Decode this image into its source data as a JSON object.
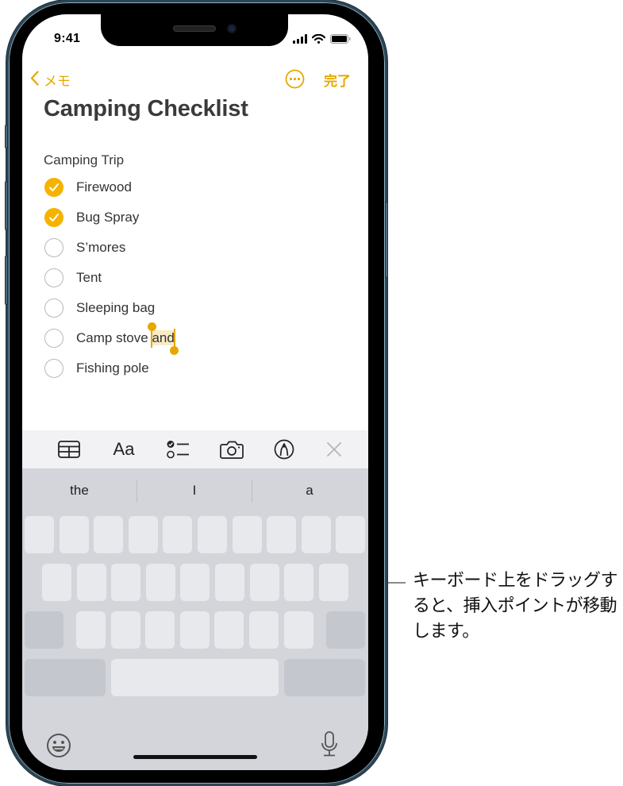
{
  "status_bar": {
    "time": "9:41",
    "icons": [
      "cellular-signal-icon",
      "wifi-icon",
      "battery-icon"
    ]
  },
  "nav": {
    "back_label": "メモ",
    "more_icon": "ellipsis-circle-icon",
    "done_label": "完了"
  },
  "note": {
    "title": "Camping Checklist",
    "subheading": "Camping Trip",
    "items": [
      {
        "text": "Firewood",
        "checked": true
      },
      {
        "text": "Bug Spray",
        "checked": true
      },
      {
        "text": "S’mores",
        "checked": false
      },
      {
        "text": "Tent",
        "checked": false
      },
      {
        "text": "Sleeping bag",
        "checked": false
      },
      {
        "text": "Camp stove ",
        "selected_text": "and",
        "checked": false
      },
      {
        "text": "Fishing pole",
        "checked": false
      }
    ]
  },
  "format_toolbar": {
    "buttons": [
      "table-icon",
      "text-format-icon",
      "checklist-icon",
      "camera-icon",
      "markup-pen-icon",
      "close-icon"
    ],
    "text_format_label": "Aa"
  },
  "keyboard": {
    "predictions": [
      "the",
      "I",
      "a"
    ],
    "state": "trackpad-mode (blank keys)",
    "bottom_icons": [
      "emoji-icon",
      "microphone-icon"
    ]
  },
  "callout": {
    "text": "キーボード上をドラッグすると、挿入ポイントが移動します。"
  },
  "colors": {
    "accent": "#e5a800",
    "checkbox_fill": "#f5b301",
    "selection_highlight": "#f8ecc6",
    "keyboard_bg": "#d3d5db",
    "toolbar_bg": "#f2f2f5"
  }
}
